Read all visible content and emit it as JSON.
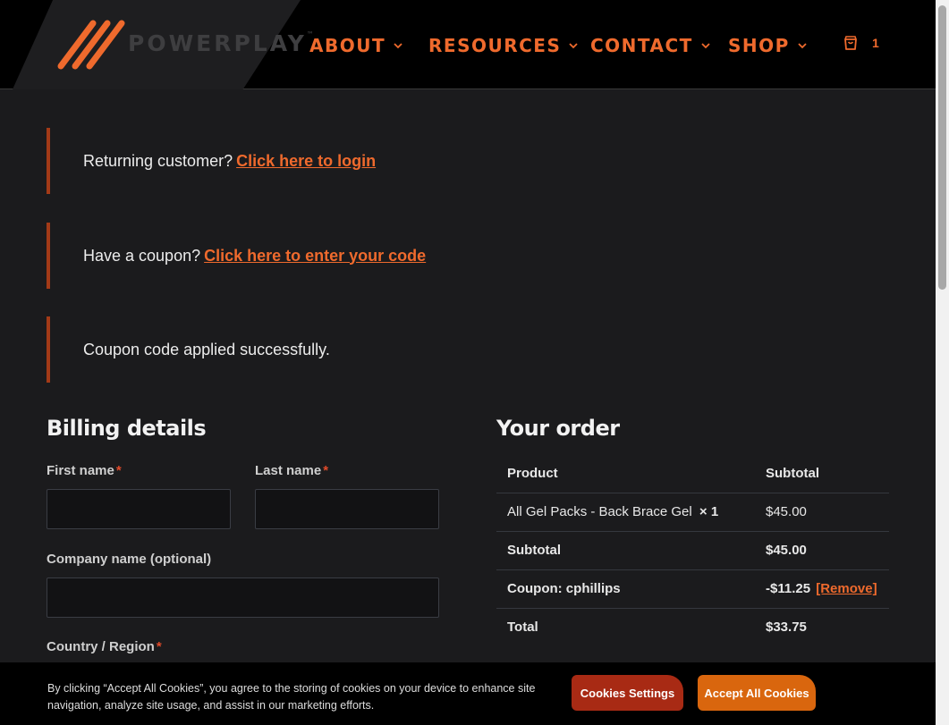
{
  "brand": {
    "name": "POWERPLAY",
    "mark": "™",
    "accent": "#ef6a2d"
  },
  "nav": [
    {
      "label": "ABOUT"
    },
    {
      "label": "RESOURCES"
    },
    {
      "label": "CONTACT"
    },
    {
      "label": "SHOP"
    }
  ],
  "cart": {
    "icon": "shopping-bag-icon",
    "count": "1"
  },
  "notices": {
    "login": {
      "text": "Returning customer?",
      "link": "Click here to login"
    },
    "coupon": {
      "text": "Have a coupon?",
      "link": "Click here to enter your code"
    },
    "success": {
      "text": "Coupon code applied successfully."
    }
  },
  "billing": {
    "title": "Billing details",
    "required_mark": "*",
    "first_name": {
      "label": "First name",
      "value": ""
    },
    "last_name": {
      "label": "Last name",
      "value": ""
    },
    "company": {
      "label": "Company name (optional)",
      "value": ""
    },
    "country": {
      "label": "Country / Region"
    }
  },
  "order": {
    "title": "Your order",
    "headers": {
      "product": "Product",
      "subtotal": "Subtotal"
    },
    "item": {
      "name": "All Gel Packs - Back Brace Gel",
      "qty": "× 1",
      "price": "$45.00"
    },
    "subtotal": {
      "label": "Subtotal",
      "value": "$45.00"
    },
    "coupon": {
      "label": "Coupon: cphillips",
      "value": "-$11.25",
      "remove": "[Remove]"
    },
    "total": {
      "label": "Total",
      "value": "$33.75"
    }
  },
  "cookies": {
    "text": "By clicking “Accept All Cookies”, you agree to the storing of cookies on your device to enhance site navigation, analyze site usage, and assist in our marketing efforts.",
    "settings_label": "Cookies Settings",
    "accept_label": "Accept All Cookies",
    "settings_color": "#a82a14",
    "accept_color": "#d9660e"
  }
}
